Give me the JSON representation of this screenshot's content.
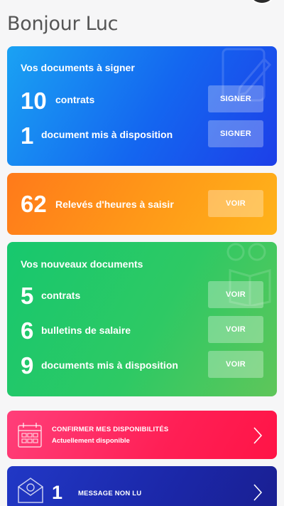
{
  "header": {
    "greeting": "Bonjour Luc"
  },
  "sign_card": {
    "title": "Vos documents à signer",
    "rows": [
      {
        "count": "10",
        "label": "contrats",
        "button": "SIGNER"
      },
      {
        "count": "1",
        "label": "document mis à disposition",
        "button": "SIGNER"
      }
    ]
  },
  "hours_card": {
    "count": "62",
    "label": "Relevés d'heures à saisir",
    "button": "VOIR"
  },
  "new_docs_card": {
    "title": "Vos nouveaux documents",
    "rows": [
      {
        "count": "5",
        "label": "contrats",
        "button": "VOIR"
      },
      {
        "count": "6",
        "label": "bulletins de salaire",
        "button": "VOIR"
      },
      {
        "count": "9",
        "label": "documents mis à disposition",
        "button": "VOIR"
      }
    ]
  },
  "availability_banner": {
    "title": "CONFIRMER MES DISPONIBILITÉS",
    "subtitle": "Actuellement disponible"
  },
  "messages_banner": {
    "count": "1",
    "label": "MESSAGE NON LU"
  },
  "colors": {
    "sign_card": "#1466f0",
    "hours_card": "#ff9a18",
    "new_docs_card": "#2ec964",
    "availability_banner": "#ff1f55",
    "messages_banner": "#1b27a8"
  },
  "icons": [
    "pencil-document-icon",
    "glasses-book-icon",
    "calendar-icon",
    "envelope-at-icon",
    "chevron-right-icon"
  ]
}
